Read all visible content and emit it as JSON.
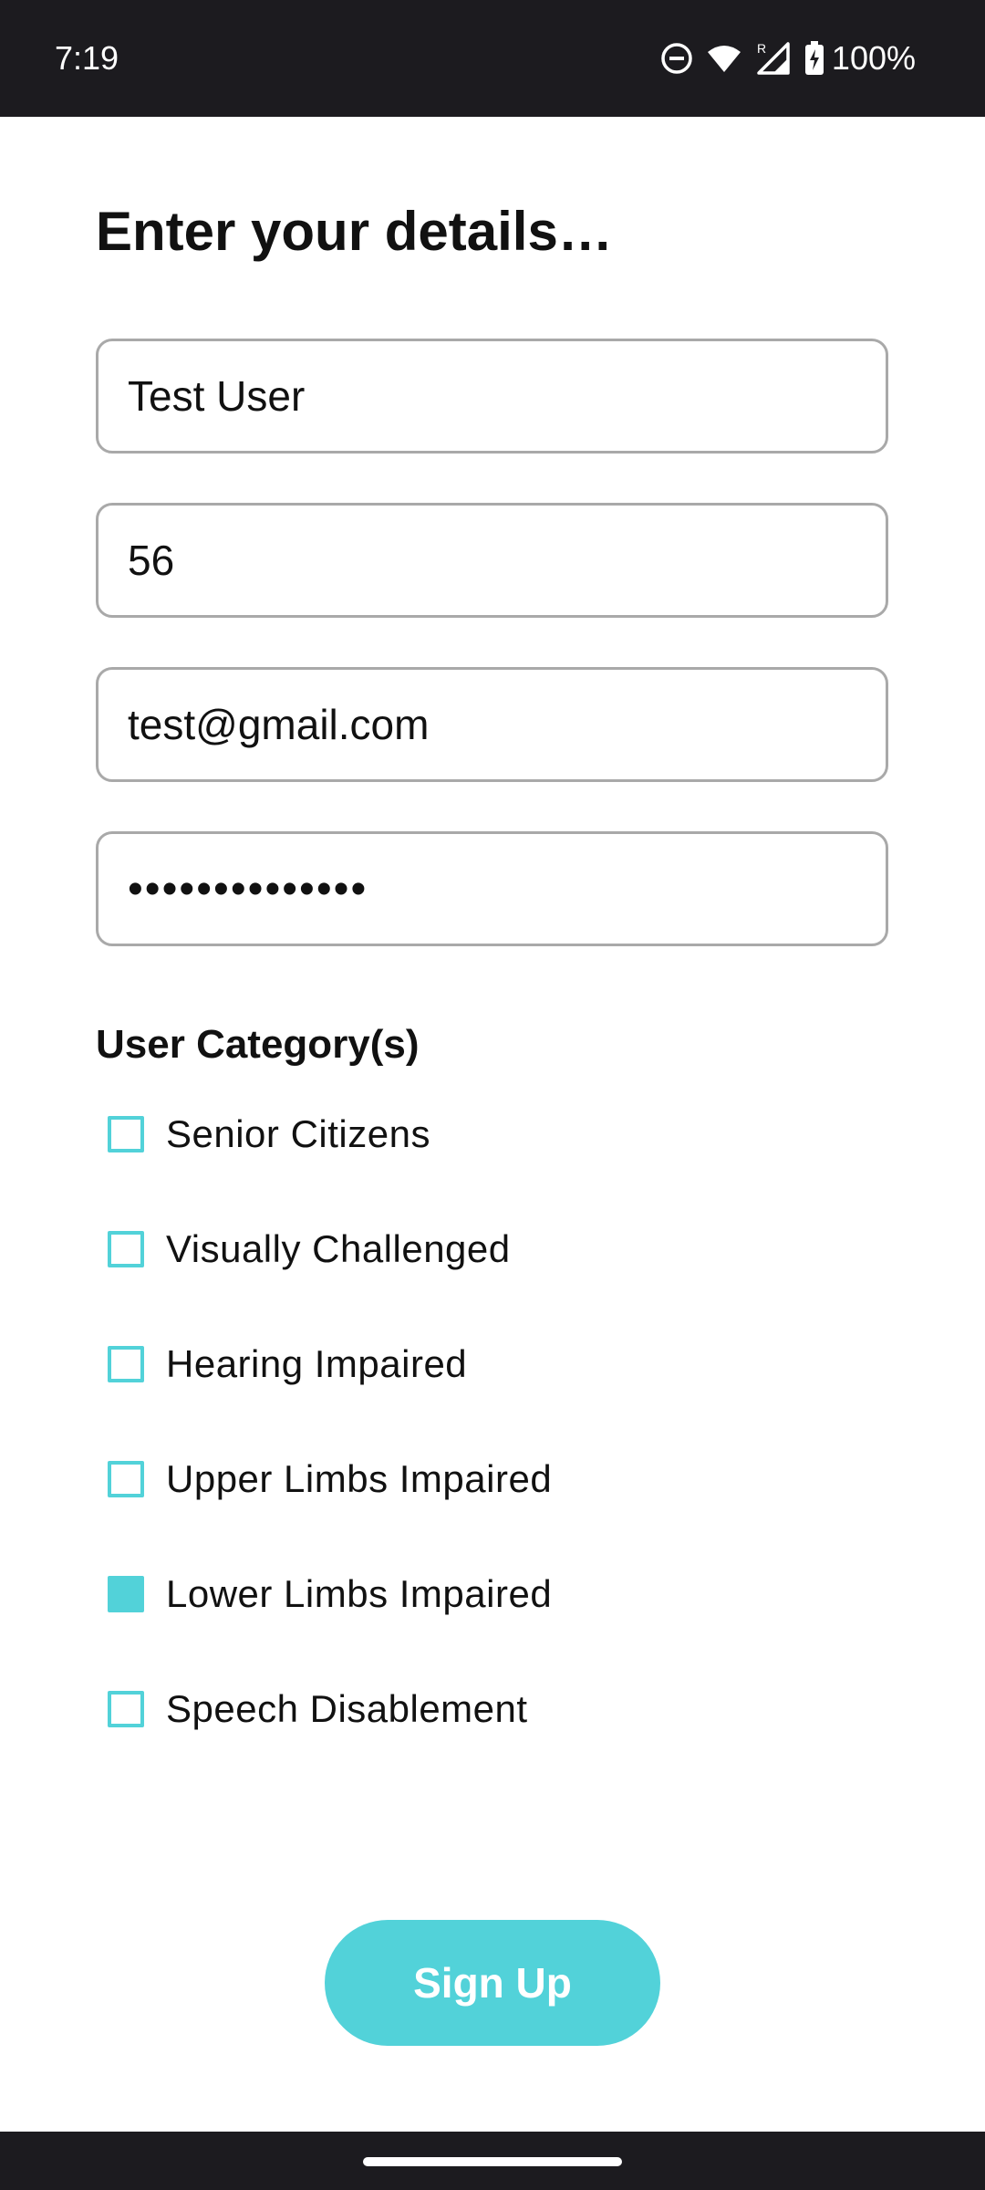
{
  "status_bar": {
    "time": "7:19",
    "battery_percent": "100%",
    "icons": [
      "do-not-disturb-icon",
      "wifi-icon",
      "signal-roaming-icon",
      "battery-charging-icon"
    ]
  },
  "form": {
    "title": "Enter your details…",
    "fields": {
      "name_value": "Test User",
      "age_value": "56",
      "email_value": "test@gmail.com",
      "password_masked": "••••••••••••••"
    },
    "category_label": "User Category(s)",
    "categories": [
      {
        "label": "Senior Citizens",
        "checked": false
      },
      {
        "label": "Visually Challenged",
        "checked": false
      },
      {
        "label": "Hearing Impaired",
        "checked": false
      },
      {
        "label": "Upper Limbs Impaired",
        "checked": false
      },
      {
        "label": "Lower Limbs Impaired",
        "checked": true
      },
      {
        "label": "Speech Disablement",
        "checked": false
      }
    ],
    "submit_label": "Sign Up"
  },
  "colors": {
    "accent": "#52d2d9",
    "system_bar": "#1c1b1f",
    "field_border": "#a9a9a9"
  }
}
